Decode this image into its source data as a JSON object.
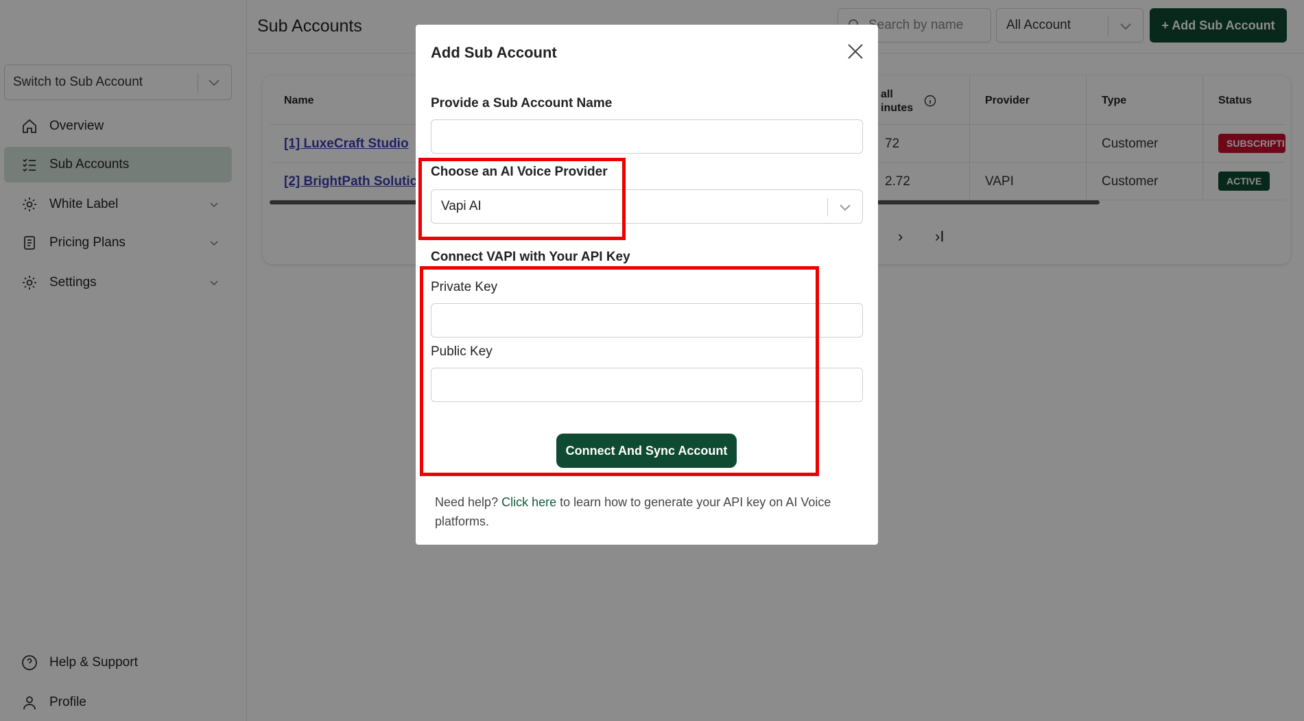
{
  "sidebar": {
    "switcher_label": "Switch to Sub Account",
    "items": [
      {
        "label": "Overview",
        "icon": "home-icon"
      },
      {
        "label": "Sub Accounts",
        "icon": "list-icon"
      },
      {
        "label": "White Label",
        "icon": "gear-icon"
      },
      {
        "label": "Pricing Plans",
        "icon": "document-icon"
      },
      {
        "label": "Settings",
        "icon": "gear-icon"
      }
    ],
    "bottom": [
      {
        "label": "Help & Support",
        "icon": "help-icon"
      },
      {
        "label": "Profile",
        "icon": "user-icon"
      }
    ]
  },
  "header": {
    "title": "Sub Accounts",
    "search_placeholder": "Search by name",
    "filter_value": "All Account",
    "add_button": "+ Add Sub Account"
  },
  "table": {
    "columns": [
      "Name",
      "all\ninutes",
      "Provider",
      "Type",
      "Status"
    ],
    "rows": [
      {
        "name": "[1] LuxeCraft Studio",
        "minutes": "72",
        "provider": "",
        "type": "Customer",
        "status": "SUBSCRIPTI"
      },
      {
        "name": "[2] BrightPath Solutic",
        "minutes": "2.72",
        "provider": "VAPI",
        "type": "Customer",
        "status": "ACTIVE"
      }
    ],
    "pager_next": "›",
    "pager_last": "›I"
  },
  "modal": {
    "title": "Add Sub Account",
    "name_label": "Provide a Sub Account Name",
    "name_value": "",
    "provider_label": "Choose an AI Voice Provider",
    "provider_value": "Vapi AI",
    "connect_label": "Connect VAPI with Your API Key",
    "private_key_label": "Private Key",
    "public_key_label": "Public Key",
    "connect_button": "Connect And Sync Account",
    "help_prefix": "Need help? ",
    "help_link": "Click here",
    "help_suffix": " to learn how to generate your API key on AI Voice platforms."
  },
  "colors": {
    "brand": "#0f4a33",
    "active_nav": "#d6e3dc",
    "badge_subscription": "#c8102e",
    "badge_active": "#0f4a33",
    "highlight": "#ee0000"
  }
}
